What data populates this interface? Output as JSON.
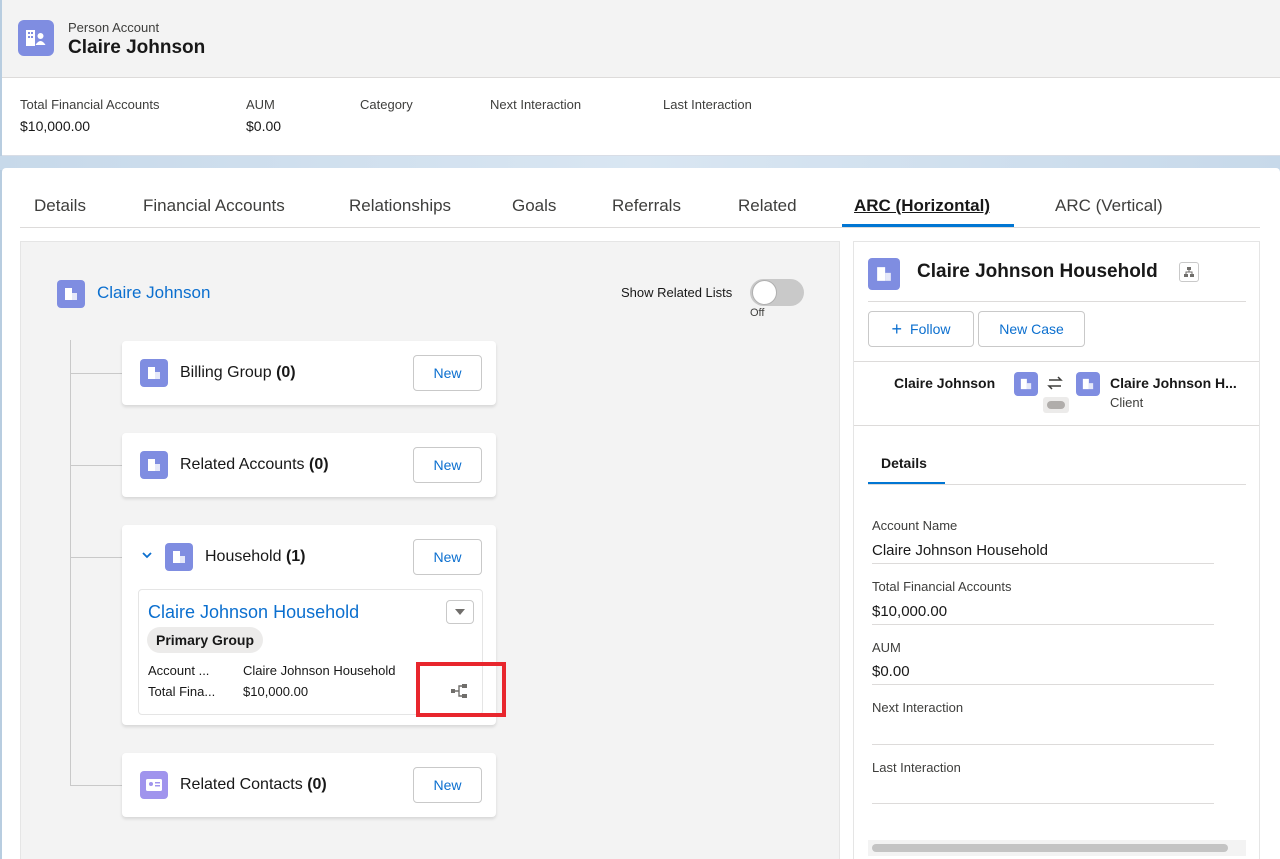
{
  "header": {
    "object_type": "Person Account",
    "record_name": "Claire Johnson",
    "highlights": [
      {
        "label": "Total Financial Accounts",
        "value": "$10,000.00"
      },
      {
        "label": "AUM",
        "value": "$0.00"
      },
      {
        "label": "Category",
        "value": ""
      },
      {
        "label": "Next Interaction",
        "value": ""
      },
      {
        "label": "Last Interaction",
        "value": ""
      }
    ]
  },
  "tabs": [
    {
      "label": "Details"
    },
    {
      "label": "Financial Accounts"
    },
    {
      "label": "Relationships"
    },
    {
      "label": "Goals"
    },
    {
      "label": "Referrals"
    },
    {
      "label": "Related"
    },
    {
      "label": "ARC (Horizontal)",
      "active": true
    },
    {
      "label": "ARC (Vertical)"
    }
  ],
  "arc": {
    "root_name": "Claire Johnson",
    "toggle_label": "Show Related Lists",
    "toggle_state": "Off",
    "groups": [
      {
        "name": "Billing Group",
        "count": "(0)",
        "new_label": "New"
      },
      {
        "name": "Related Accounts",
        "count": "(0)",
        "new_label": "New"
      },
      {
        "name": "Household",
        "count": "(1)",
        "new_label": "New"
      },
      {
        "name": "Related Contacts",
        "count": "(0)",
        "new_label": "New"
      }
    ],
    "household_record": {
      "name": "Claire Johnson Household",
      "badge": "Primary Group",
      "fields": [
        {
          "label": "Account ...",
          "value": "Claire Johnson Household"
        },
        {
          "label": "Total Fina...",
          "value": "$10,000.00"
        }
      ]
    }
  },
  "right_panel": {
    "title": "Claire Johnson Household",
    "follow_label": "Follow",
    "new_case_label": "New Case",
    "relationship": {
      "from": "Claire Johnson",
      "to": "Claire Johnson H...",
      "role": "Client"
    },
    "details_tab": "Details",
    "fields": [
      {
        "label": "Account Name",
        "value": "Claire Johnson Household"
      },
      {
        "label": "Total Financial Accounts",
        "value": "$10,000.00"
      },
      {
        "label": "AUM",
        "value": "$0.00"
      },
      {
        "label": "Next Interaction",
        "value": ""
      },
      {
        "label": "Last Interaction",
        "value": ""
      }
    ]
  },
  "colors": {
    "account_icon": "#7f8de1",
    "contact_icon": "#a094ed",
    "link": "#0b6fcf",
    "active_tab": "#0176d3",
    "highlight_box": "#e8262d"
  }
}
